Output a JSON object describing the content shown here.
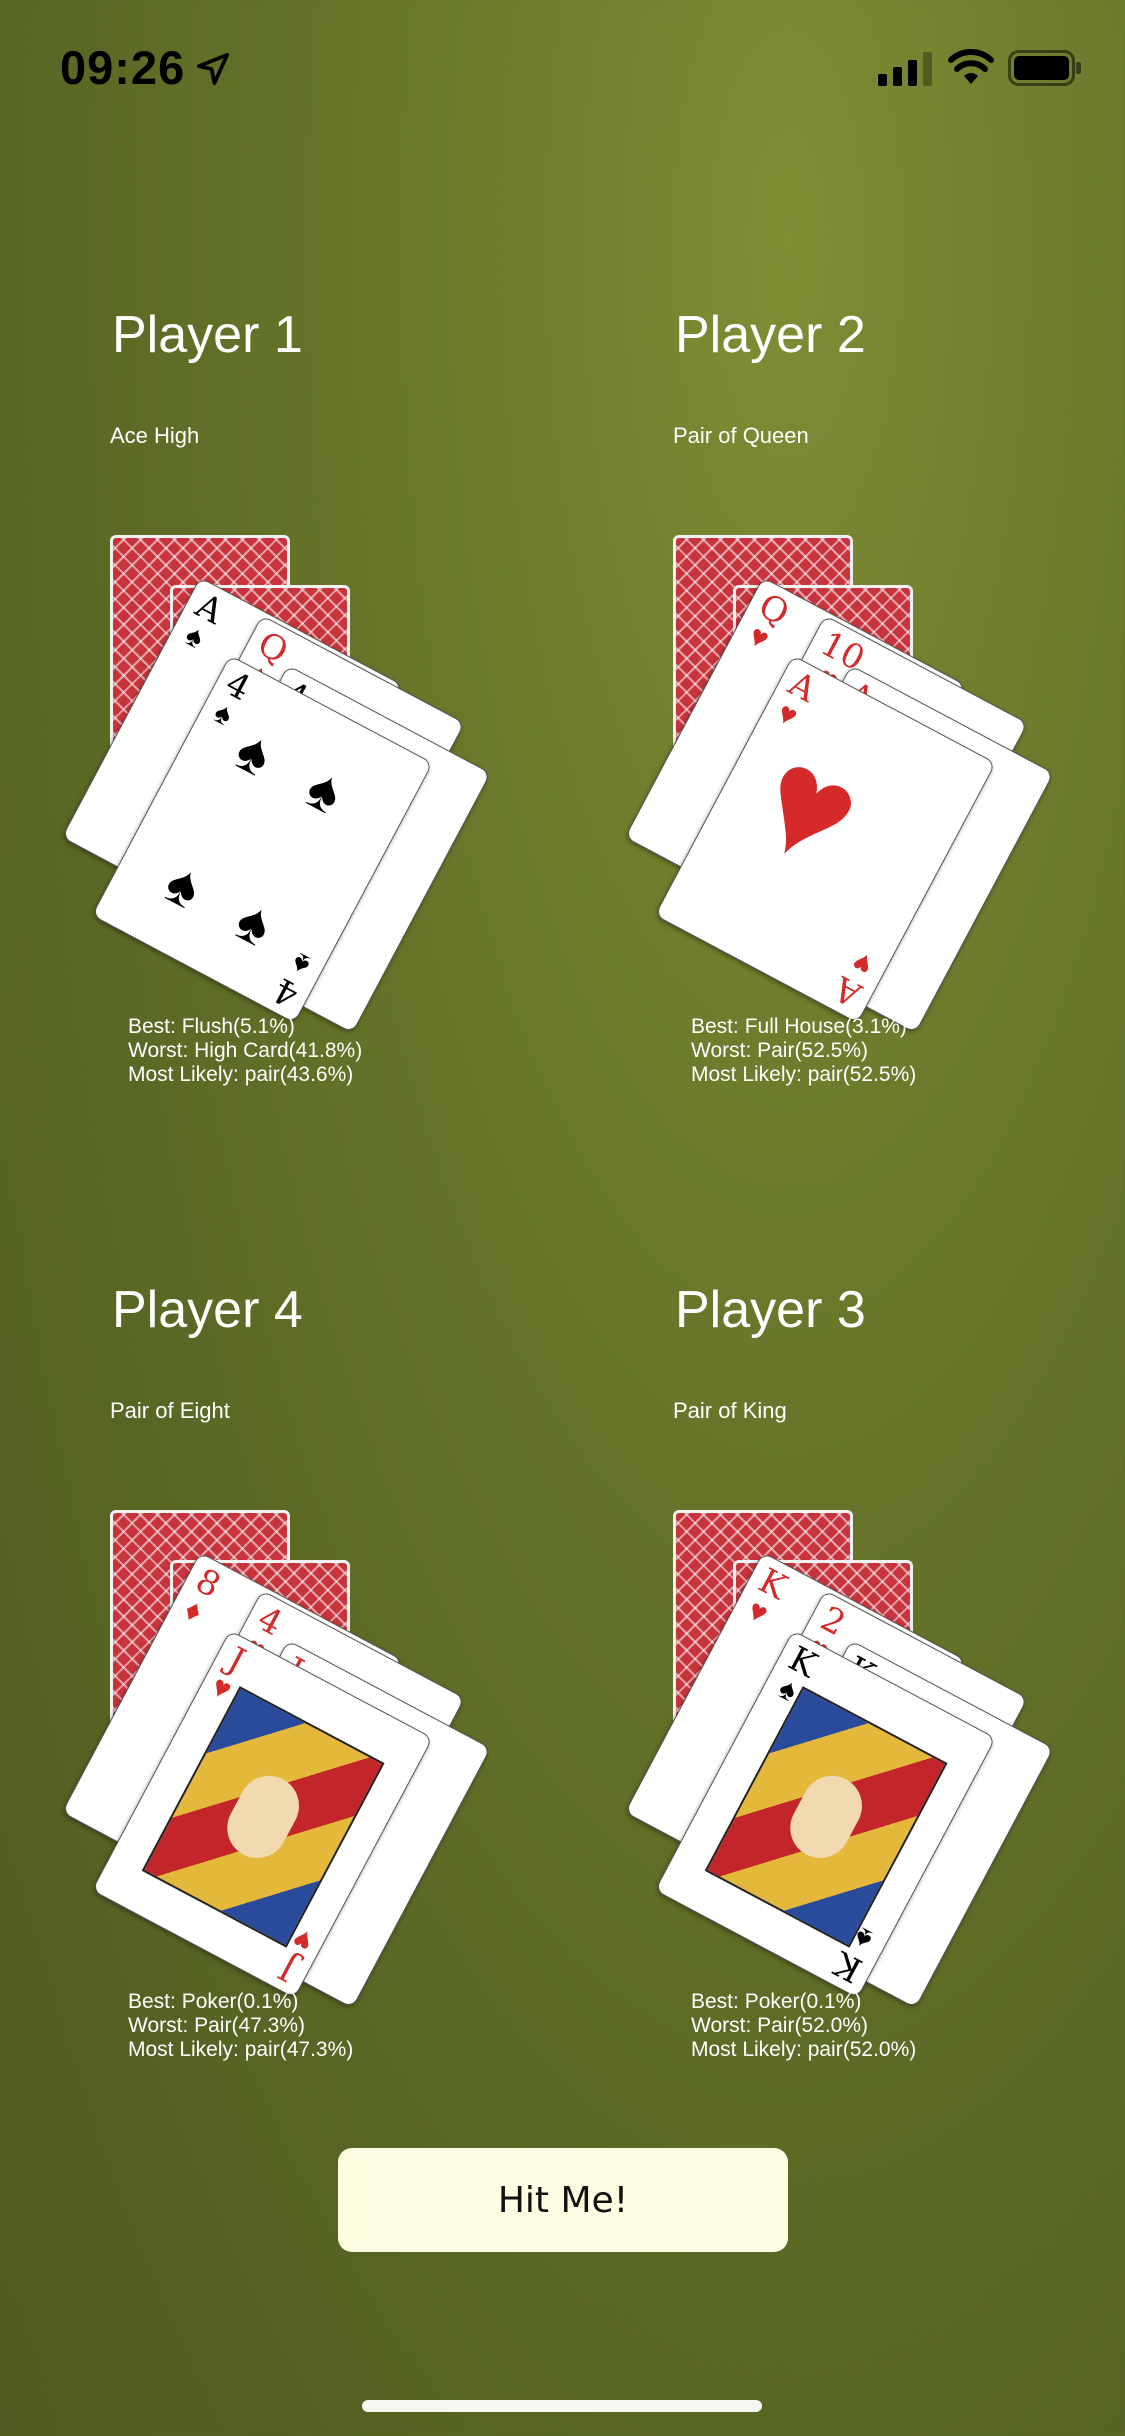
{
  "status_bar": {
    "time": "09:26",
    "icons": [
      "location-arrow-icon",
      "cellular-signal-icon",
      "wifi-icon",
      "battery-icon"
    ]
  },
  "colors": {
    "table_felt": "#66772b",
    "button_background": "#fefde2",
    "card_back": "#c8343c",
    "suit_red": "#d42a2a"
  },
  "players": [
    {
      "name": "Player 1",
      "hand": "Ace High",
      "cards": [
        {
          "rank": "A",
          "suit": "♠",
          "color": "black"
        },
        {
          "rank": "Q",
          "suit": "♦",
          "color": "red"
        },
        {
          "rank": "4",
          "suit": "♠",
          "color": "black"
        },
        {
          "rank": "4",
          "suit": "♠",
          "color": "black"
        }
      ],
      "stats": {
        "best": "Best: Flush(5.1%)",
        "worst": "Worst: High Card(41.8%)",
        "most_likely": "Most Likely: pair(43.6%)"
      }
    },
    {
      "name": "Player 2",
      "hand": "Pair of Queen",
      "cards": [
        {
          "rank": "Q",
          "suit": "♥",
          "color": "red"
        },
        {
          "rank": "10",
          "suit": "♥",
          "color": "red"
        },
        {
          "rank": "A",
          "suit": "♥",
          "color": "red"
        },
        {
          "rank": "A",
          "suit": "♥",
          "color": "red"
        }
      ],
      "stats": {
        "best": "Best: Full House(3.1%)",
        "worst": "Worst: Pair(52.5%)",
        "most_likely": "Most Likely: pair(52.5%)"
      }
    },
    {
      "name": "Player 4",
      "hand": "Pair of Eight",
      "cards": [
        {
          "rank": "8",
          "suit": "♦",
          "color": "red"
        },
        {
          "rank": "4",
          "suit": "♥",
          "color": "red"
        },
        {
          "rank": "J",
          "suit": "♥",
          "color": "red"
        },
        {
          "rank": "J",
          "suit": "♥",
          "color": "red"
        }
      ],
      "stats": {
        "best": "Best: Poker(0.1%)",
        "worst": "Worst: Pair(47.3%)",
        "most_likely": "Most Likely: pair(47.3%)"
      }
    },
    {
      "name": "Player 3",
      "hand": "Pair of King",
      "cards": [
        {
          "rank": "K",
          "suit": "♥",
          "color": "red"
        },
        {
          "rank": "2",
          "suit": "♥",
          "color": "red"
        },
        {
          "rank": "K",
          "suit": "♠",
          "color": "black"
        },
        {
          "rank": "K",
          "suit": "♠",
          "color": "black"
        }
      ],
      "stats": {
        "best": "Best: Poker(0.1%)",
        "worst": "Worst: Pair(52.0%)",
        "most_likely": "Most Likely: pair(52.0%)"
      }
    }
  ],
  "hit_button": {
    "label": "Hit Me!"
  }
}
